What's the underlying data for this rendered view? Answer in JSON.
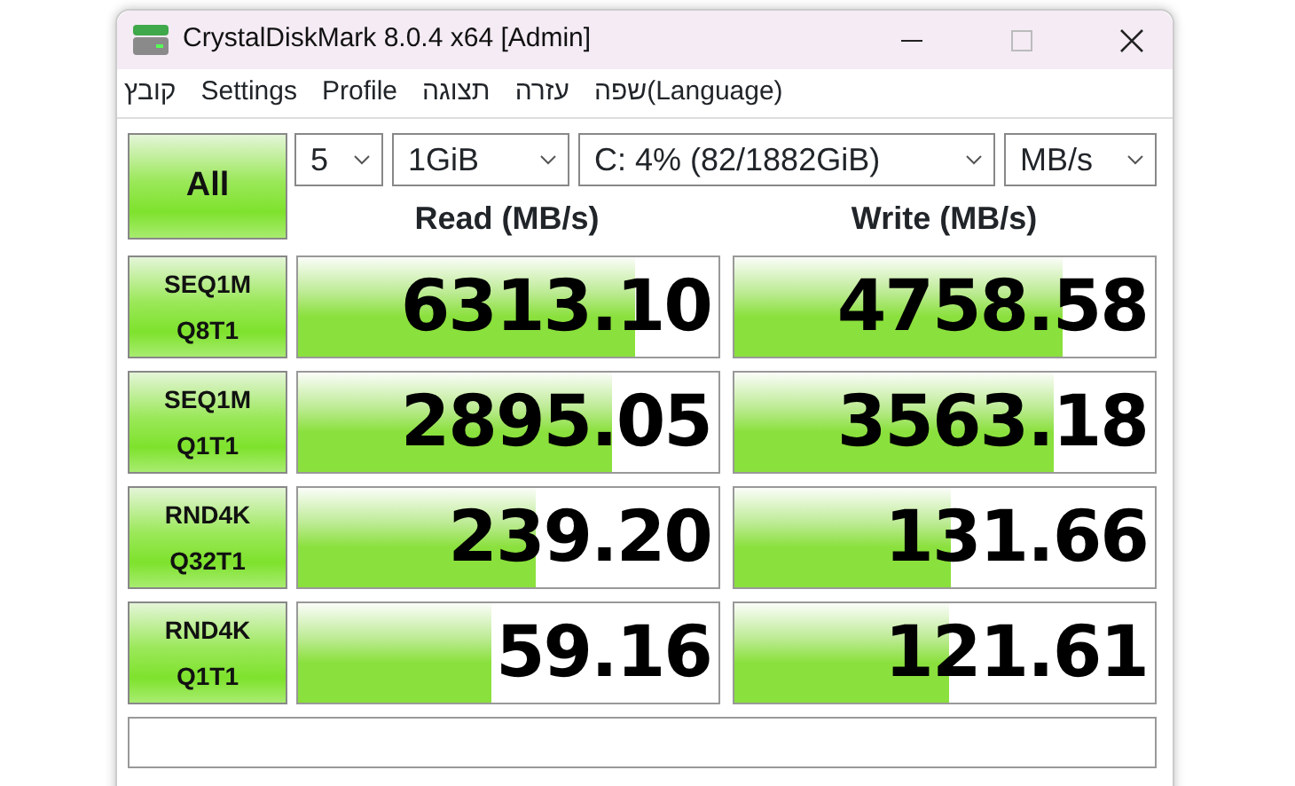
{
  "window": {
    "title": "CrystalDiskMark 8.0.4 x64 [Admin]"
  },
  "menu": [
    "קובץ",
    "Settings",
    "Profile",
    "תצוגה",
    "עזרה",
    "שפה(Language)"
  ],
  "all_button": "All",
  "selectors": [
    {
      "value": "5"
    },
    {
      "value": "1GiB"
    },
    {
      "value": "C: 4% (82/1882GiB)"
    },
    {
      "value": "MB/s"
    }
  ],
  "columns": [
    "Read (MB/s)",
    "Write (MB/s)"
  ],
  "tests": [
    {
      "line1": "SEQ1M",
      "line2": "Q8T1",
      "read": {
        "value": "6313.10",
        "level": 0.8
      },
      "write": {
        "value": "4758.58",
        "level": 0.78
      }
    },
    {
      "line1": "SEQ1M",
      "line2": "Q1T1",
      "read": {
        "value": "2895.05",
        "level": 0.745
      },
      "write": {
        "value": "3563.18",
        "level": 0.76
      }
    },
    {
      "line1": "RND4K",
      "line2": "Q32T1",
      "read": {
        "value": "239.20",
        "level": 0.565
      },
      "write": {
        "value": "131.66",
        "level": 0.515
      }
    },
    {
      "line1": "RND4K",
      "line2": "Q1T1",
      "read": {
        "value": "59.16",
        "level": 0.46
      },
      "write": {
        "value": "121.61",
        "level": 0.51
      }
    }
  ]
}
